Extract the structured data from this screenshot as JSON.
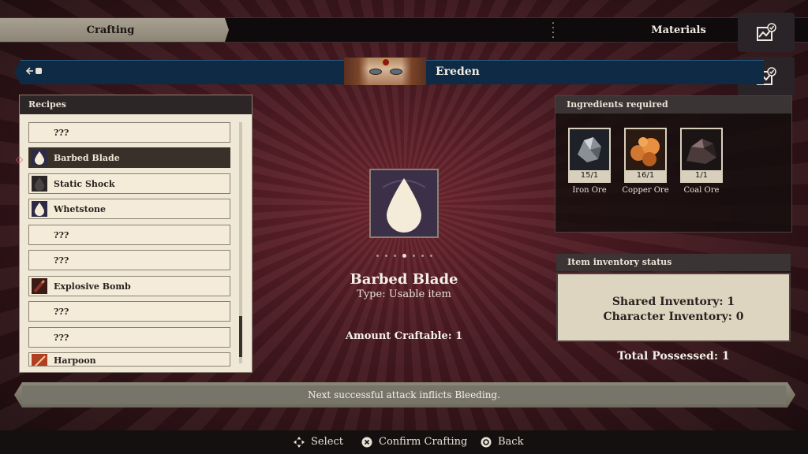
{
  "tabs": {
    "crafting": "Crafting",
    "materials": "Materials"
  },
  "character": {
    "name": "Ereden",
    "back_icon": "back-arrow-icon"
  },
  "recipes": {
    "header": "Recipes",
    "items": [
      {
        "label": "???",
        "icon": "none"
      },
      {
        "label": "Barbed Blade",
        "icon": "drop-icon",
        "selected": true
      },
      {
        "label": "Static Shock",
        "icon": "dark-drop-icon"
      },
      {
        "label": "Whetstone",
        "icon": "drop-icon"
      },
      {
        "label": "???",
        "icon": "none"
      },
      {
        "label": "???",
        "icon": "none"
      },
      {
        "label": "Explosive Bomb",
        "icon": "bomb-icon"
      },
      {
        "label": "???",
        "icon": "none"
      },
      {
        "label": "???",
        "icon": "none"
      },
      {
        "label": "Harpoon",
        "icon": "harpoon-icon"
      }
    ]
  },
  "selected_item": {
    "name": "Barbed Blade",
    "type": "Type: Usable item",
    "amount_craftable": "Amount Craftable: 1",
    "page_dots": 7,
    "active_dot": 4
  },
  "ingredients": {
    "header": "Ingredients required",
    "items": [
      {
        "name": "Iron Ore",
        "count": "15/1"
      },
      {
        "name": "Copper Ore",
        "count": "16/1"
      },
      {
        "name": "Coal Ore",
        "count": "1/1"
      }
    ]
  },
  "inventory": {
    "header": "Item inventory status",
    "shared": "Shared Inventory: 1",
    "character": "Character Inventory: 0",
    "total": "Total Possessed: 1"
  },
  "description": "Next successful attack inflicts Bleeding.",
  "footer": {
    "select": "Select",
    "confirm": "Confirm Crafting",
    "back": "Back"
  },
  "colors": {
    "selected_row": "#3a302a",
    "panel": "#f0e8d6",
    "char_bar": "#0e2a44"
  }
}
